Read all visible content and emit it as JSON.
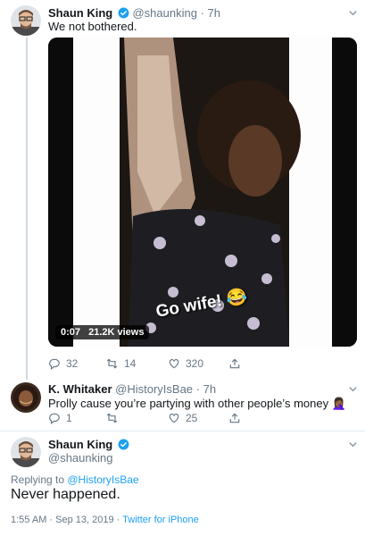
{
  "tweet1": {
    "name": "Shaun King",
    "handle": "@shaunking",
    "dot": "·",
    "time": "7h",
    "text": "We not bothered.",
    "video": {
      "caption": "Go wife! 😂",
      "duration": "0:07",
      "views": "21.2K views"
    },
    "actions": {
      "replies": "32",
      "retweets": "14",
      "likes": "320"
    }
  },
  "tweet2": {
    "name": "K. Whitaker",
    "handle": "@HistoryIsBae",
    "dot": "·",
    "time": "7h",
    "text": "Prolly cause you’re partying with other people’s money 🤦🏾‍♀️",
    "actions": {
      "replies": "1",
      "retweets": "",
      "likes": "25"
    }
  },
  "main": {
    "name": "Shaun King",
    "handle": "@shaunking",
    "replying_prefix": "Replying to ",
    "replying_to": "@HistoryIsBae",
    "text": "Never happened.",
    "timestamp": "1:55 AM · Sep 13, 2019 · ",
    "source": "Twitter for iPhone"
  },
  "colors": {
    "link": "#1da1f2",
    "muted": "#657786",
    "verified": "#1da1f2"
  },
  "icons": [
    "verified-badge-icon",
    "chevron-down-icon",
    "reply-icon",
    "retweet-icon",
    "like-icon",
    "share-icon"
  ]
}
